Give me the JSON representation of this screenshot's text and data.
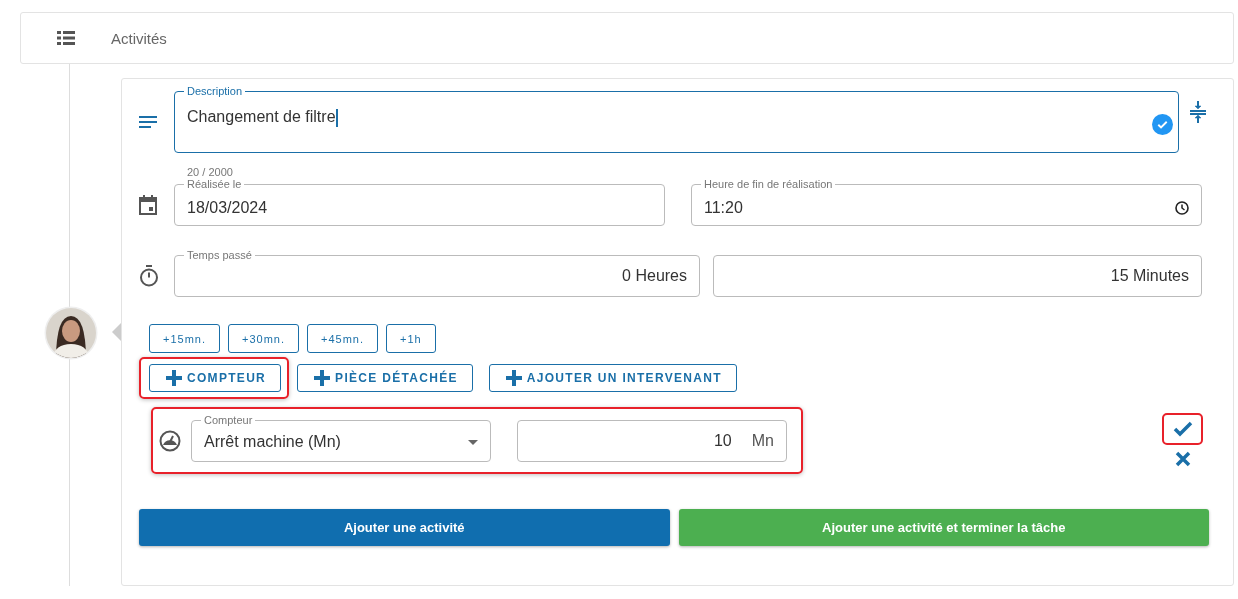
{
  "header": {
    "title": "Activités"
  },
  "description": {
    "label": "Description",
    "value": "Changement de filtre",
    "counter": "20 / 2000",
    "valid": true
  },
  "date_field": {
    "label": "Réalisée le",
    "value": "18/03/2024"
  },
  "time_field": {
    "label": "Heure de fin de réalisation",
    "value": "11:20"
  },
  "time_spent": {
    "label": "Temps passé",
    "hours": "0 Heures",
    "minutes": "15 Minutes"
  },
  "quick_buttons": [
    "+15mn.",
    "+30mn.",
    "+45mn.",
    "+1h"
  ],
  "action_buttons": [
    {
      "label": "COMPTEUR",
      "highlighted": true
    },
    {
      "label": "PIÈCE DÉTACHÉE",
      "highlighted": false
    },
    {
      "label": "AJOUTER UN INTERVENANT",
      "highlighted": false
    }
  ],
  "counter_row": {
    "label": "Compteur",
    "value": "Arrêt machine (Mn)",
    "amount": "10",
    "unit": "Mn",
    "highlighted": true,
    "confirm_highlighted": true
  },
  "submit_buttons": [
    {
      "label": "Ajouter une activité",
      "kind": "primary"
    },
    {
      "label": "Ajouter une activité et terminer la tâche",
      "kind": "success"
    }
  ]
}
